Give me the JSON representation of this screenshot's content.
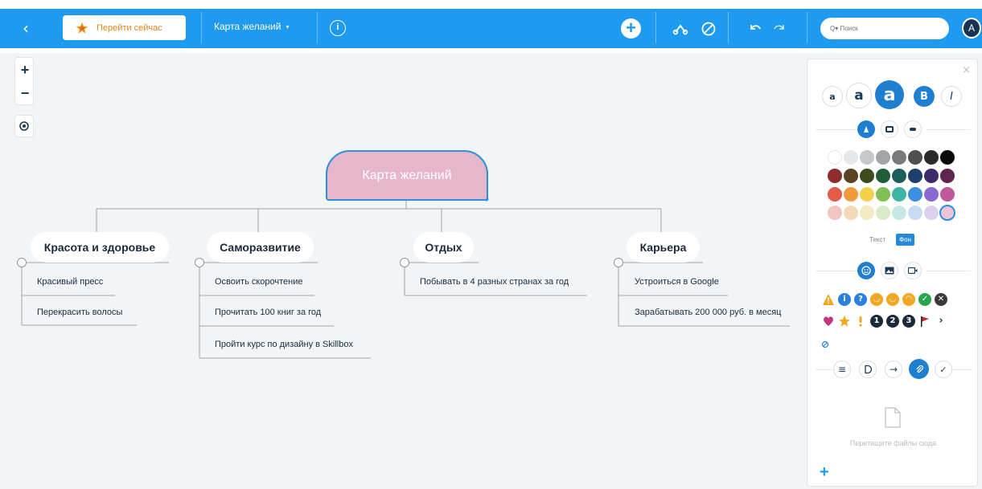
{
  "toolbar": {
    "back_icon": "chevron-left-icon",
    "goto_label": "Перейти сейчас",
    "map_title": "Карта желаний",
    "map_caret": "▾",
    "info_symbol": "i",
    "add_symbol": "+",
    "search_placeholder": "Q▾ Поиск",
    "avatar_letter": "A"
  },
  "zoom": {
    "in": "+",
    "out": "−"
  },
  "mindmap": {
    "central": "Карта желаний",
    "branches": [
      {
        "title": "Красота и здоровье",
        "items": [
          "Красивый пресс",
          "Перекрасить волосы"
        ]
      },
      {
        "title": "Саморазвитие",
        "items": [
          "Освоить скорочтение",
          "Прочитать 100 книг за год",
          "Пройти курс по дизайну в Skillbox"
        ]
      },
      {
        "title": "Отдых",
        "items": [
          "Побывать в 4 разных странах за год"
        ]
      },
      {
        "title": "Карьера",
        "items": [
          "Устроиться в Google",
          "Зарабатывать 200 000 руб. в месяц"
        ]
      }
    ]
  },
  "panel": {
    "close": "×",
    "font_sizes": [
      "a",
      "a",
      "a"
    ],
    "bold": "B",
    "italic": "I",
    "text_label": "Текст",
    "bg_label": "Фон",
    "drop_text": "Перетащите файлы сюда",
    "add": "+"
  },
  "colors": {
    "accent": "#1e9af0",
    "central_fill": "#e6b6cb",
    "goto_text": "#e8841a"
  }
}
